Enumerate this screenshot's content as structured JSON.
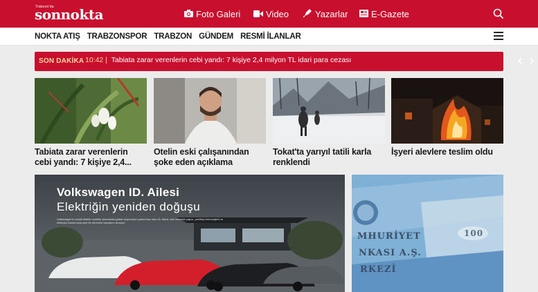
{
  "brand": {
    "small": "Trabzon'da",
    "name": "sonnokta"
  },
  "topnav": {
    "foto": "Foto Galeri",
    "video": "Video",
    "yazarlar": "Yazarlar",
    "egazete": "E-Gazete"
  },
  "categories": [
    "NOKTA ATIŞ",
    "TRABZONSPOR",
    "TRABZON",
    "GÜNDEM",
    "RESMİ İLANLAR"
  ],
  "ticker": {
    "label": "SON DAKİKA",
    "time": "10:42 |",
    "headline": "Tabiata zarar verenlerin cebi yandı: 7 kişiye 2,4 milyon TL idari para cezası"
  },
  "cards": [
    {
      "title": "Tabiata zarar verenlerin cebi yandı: 7 kişiye 2,4..."
    },
    {
      "title": "Otelin eski çalışanından şoke eden açıklama"
    },
    {
      "title": "Tokat'ta yarıyıl tatili karla renklendi"
    },
    {
      "title": "İşyeri alevlere teslim oldu"
    }
  ],
  "ad": {
    "title": "Volkswagen ID. Ailesi",
    "subtitle": "Elektriğin yeniden doğuşu",
    "body": "Volkswagen'in sürdürülebilir mobilite alanındaki global vizyonunun yansıması olan ID. Ailesi; tam elektrikli yapısı, yenilikçi teknolojileri ve etkileyici tasarımıyla yeni bir dönemin kapılarını aralıyor."
  },
  "side": {
    "line1": "MHURİYET",
    "line2": "NKASI A.Ş.",
    "line3": "RKEZİ",
    "note": "100"
  },
  "colors": {
    "brand_red": "#c8102e",
    "ticker_label": "#ffd9a0",
    "page_bg": "#ececec"
  }
}
